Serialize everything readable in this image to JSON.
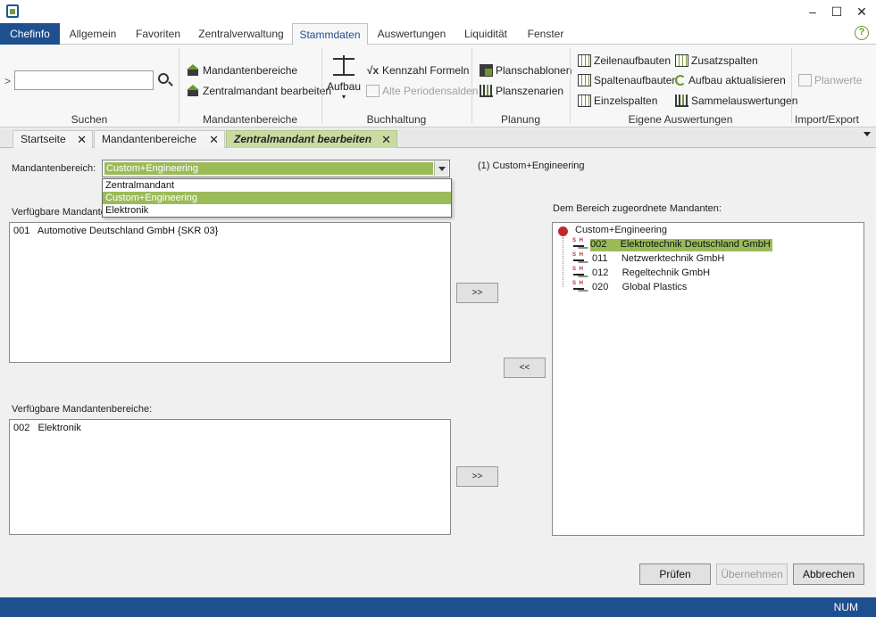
{
  "menu": {
    "tabs": [
      "Chefinfo",
      "Allgemein",
      "Favoriten",
      "Zentralverwaltung",
      "Stammdaten",
      "Auswertungen",
      "Liquidität",
      "Fenster"
    ]
  },
  "ribbon": {
    "suchen": {
      "label": "Suchen",
      "input_value": ""
    },
    "mandantenbereiche": {
      "label": "Mandantenbereiche",
      "btn1": "Mandantenbereiche",
      "btn2": "Zentralmandant bearbeiten"
    },
    "buchhaltung": {
      "label": "Buchhaltung",
      "aufbau": "Aufbau",
      "kennzahl": "Kennzahl Formeln",
      "alte_perioden": "Alte Periodensalden"
    },
    "planung": {
      "label": "Planung",
      "planschablonen": "Planschablonen",
      "planszenarien": "Planszenarien"
    },
    "eigene": {
      "label": "Eigene Auswertungen",
      "zeilenaufbauten": "Zeilenaufbauten",
      "spaltenaufbauten": "Spaltenaufbauten",
      "einzelspalten": "Einzelspalten",
      "zusatzspalten": "Zusatzspalten",
      "aufbau_aktualisieren": "Aufbau aktualisieren",
      "sammelauswertungen": "Sammelauswertungen"
    },
    "import": {
      "label": "Import/Export",
      "planwerte": "Planwerte"
    }
  },
  "doctabs": [
    "Startseite",
    "Mandantenbereiche",
    "Zentralmandant bearbeiten"
  ],
  "form": {
    "mandantenbereich_label": "Mandantenbereich:",
    "combo_value": "Custom+Engineering",
    "dropdown_options": [
      "Zentralmandant",
      "Custom+Engineering",
      "Elektronik"
    ],
    "info_text": "(1)   Custom+Engineering",
    "verfuegbare_mandanten_label": "Verfügbare Mandanten:",
    "verfuegbare_mandanten": [
      "001   Automotive Deutschland GmbH {SKR 03}"
    ],
    "verfuegbare_bereiche_label": "Verfügbare Mandantenbereiche:",
    "verfuegbare_bereiche": [
      "002   Elektronik"
    ],
    "zugeordnet_label": "Dem Bereich zugeordnete Mandanten:",
    "tree_root": "Custom+Engineering",
    "tree_children": [
      "002     Elektrotechnik Deutschland GmbH",
      "011     Netzwerktechnik GmbH",
      "012     Regeltechnik GmbH",
      "020     Global Plastics"
    ],
    "move_right": ">>",
    "move_left": "<<",
    "move_right2": ">>"
  },
  "buttons": {
    "pruefen": "Prüfen",
    "uebernehmen": "Übernehmen",
    "abbrechen": "Abbrechen"
  },
  "status": {
    "num": "NUM"
  }
}
